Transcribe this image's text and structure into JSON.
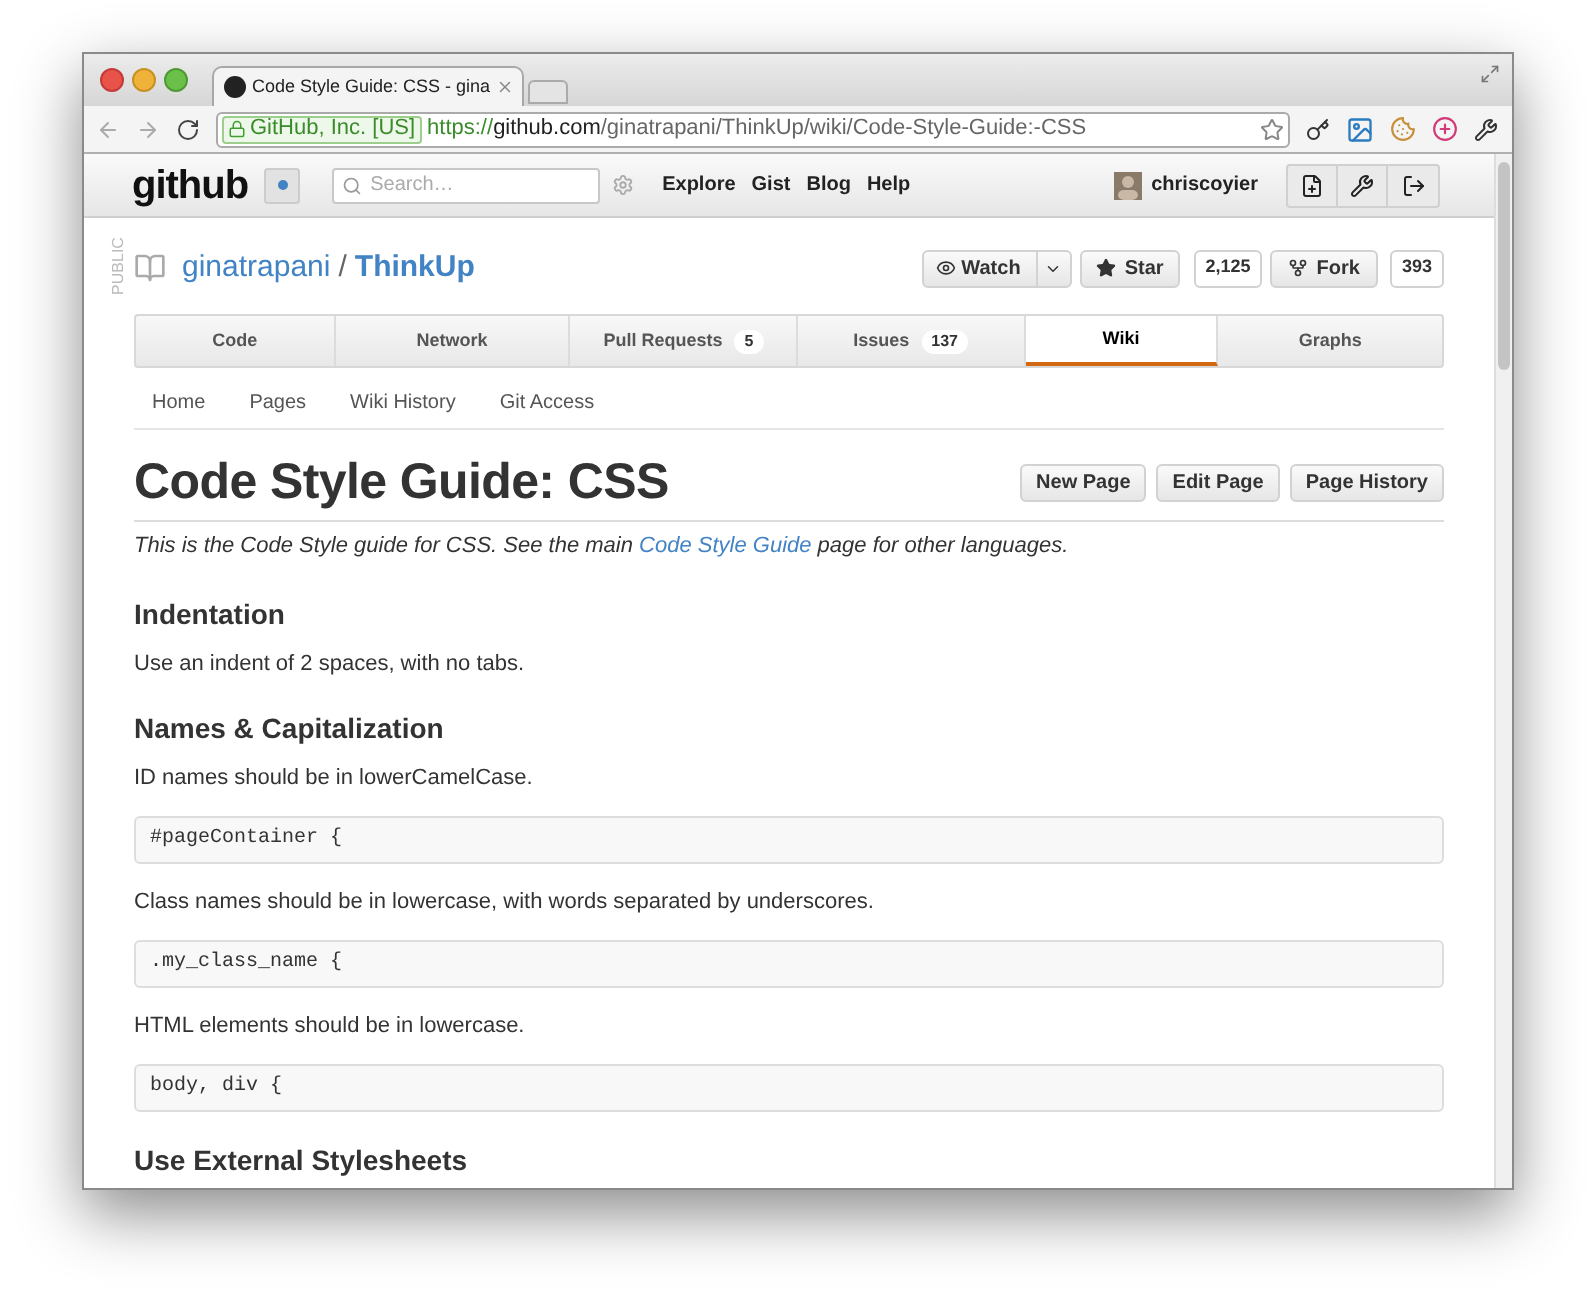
{
  "browser": {
    "tab_title": "Code Style Guide: CSS - gina",
    "security_label": "GitHub, Inc. [US]",
    "url_scheme": "https://",
    "url_host": "github.com",
    "url_path": "/ginatrapani/ThinkUp/wiki/Code-Style-Guide:-CSS"
  },
  "header": {
    "logo": "github",
    "search_placeholder": "Search…",
    "nav": [
      "Explore",
      "Gist",
      "Blog",
      "Help"
    ],
    "username": "chriscoyier"
  },
  "repo": {
    "visibility": "PUBLIC",
    "owner": "ginatrapani",
    "separator": "/",
    "name": "ThinkUp",
    "watch": "Watch",
    "star": "Star",
    "star_count": "2,125",
    "fork": "Fork",
    "fork_count": "393"
  },
  "tabs": [
    {
      "label": "Code",
      "selected": false
    },
    {
      "label": "Network",
      "selected": false
    },
    {
      "label": "Pull Requests",
      "count": "5",
      "selected": false
    },
    {
      "label": "Issues",
      "count": "137",
      "selected": false
    },
    {
      "label": "Wiki",
      "selected": true
    },
    {
      "label": "Graphs",
      "selected": false
    }
  ],
  "subnav": [
    "Home",
    "Pages",
    "Wiki History",
    "Git Access"
  ],
  "page": {
    "title": "Code Style Guide: CSS",
    "buttons": [
      "New Page",
      "Edit Page",
      "Page History"
    ],
    "intro": {
      "before": "This is the Code Style guide for CSS. See the main ",
      "link": "Code Style Guide",
      "after": " page for other languages."
    },
    "blocks": [
      {
        "kind": "heading",
        "text": "Indentation"
      },
      {
        "kind": "paragraph",
        "text": "Use an indent of 2 spaces, with no tabs."
      },
      {
        "kind": "heading",
        "text": "Names & Capitalization"
      },
      {
        "kind": "paragraph",
        "text": "ID names should be in lowerCamelCase."
      },
      {
        "kind": "code",
        "text": "#pageContainer {"
      },
      {
        "kind": "paragraph",
        "text": "Class names should be in lowercase, with words separated by underscores."
      },
      {
        "kind": "code",
        "text": ".my_class_name {"
      },
      {
        "kind": "paragraph",
        "text": "HTML elements should be in lowercase."
      },
      {
        "kind": "code",
        "text": "body, div {"
      },
      {
        "kind": "heading",
        "text": "Use External Stylesheets"
      }
    ]
  }
}
